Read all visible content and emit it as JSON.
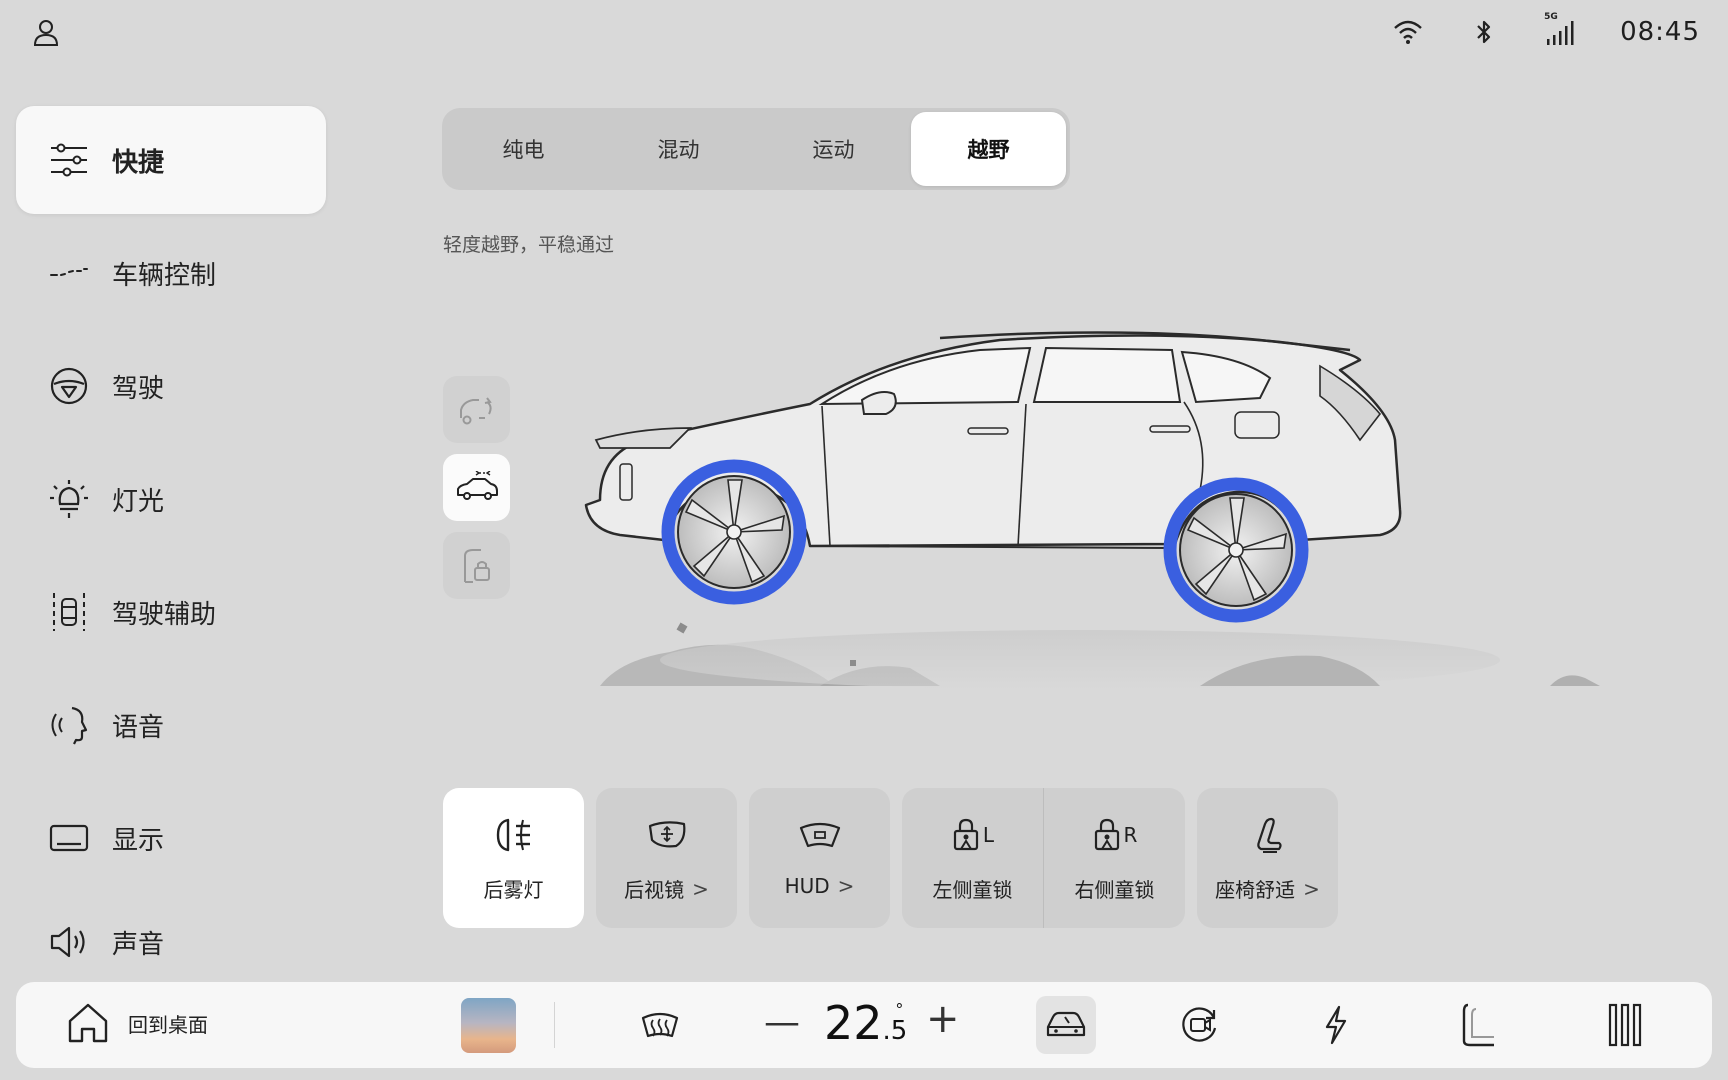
{
  "status": {
    "network_badge": "5G",
    "time": "08:45"
  },
  "sidebar": {
    "items": [
      {
        "label": "快捷",
        "icon": "sliders-icon"
      },
      {
        "label": "车辆控制",
        "icon": "vehicle-control-icon"
      },
      {
        "label": "驾驶",
        "icon": "steering-wheel-icon"
      },
      {
        "label": "灯光",
        "icon": "light-icon"
      },
      {
        "label": "驾驶辅助",
        "icon": "driver-assist-icon"
      },
      {
        "label": "语音",
        "icon": "voice-icon"
      },
      {
        "label": "显示",
        "icon": "display-icon"
      },
      {
        "label": "声音",
        "icon": "speaker-icon"
      }
    ]
  },
  "modes": {
    "tabs": [
      "纯电",
      "混动",
      "运动",
      "越野"
    ],
    "selected": "越野",
    "description": "轻度越野，平稳通过"
  },
  "quick": {
    "rear_fog": "后雾灯",
    "mirror": "后视镜",
    "hud": "HUD",
    "left_lock": "左侧童锁",
    "left_lock_letter": "L",
    "right_lock": "右侧童锁",
    "right_lock_letter": "R",
    "seat": "座椅舒适",
    "chevron": ">"
  },
  "dock": {
    "home_label": "回到桌面",
    "temp_int": "22",
    "temp_dec": ".5",
    "temp_unit": "°",
    "minus": "—",
    "plus": "+"
  },
  "colors": {
    "background": "#d9d9d9",
    "active": "#ffffff",
    "wheel_highlight": "#3a5fe0"
  }
}
